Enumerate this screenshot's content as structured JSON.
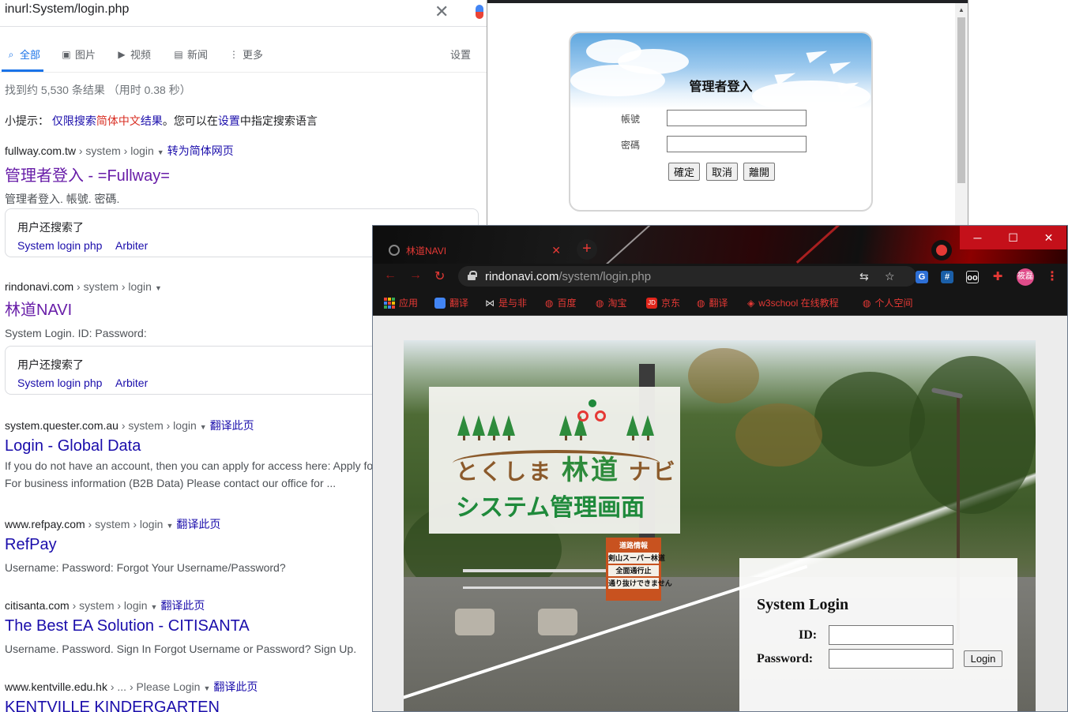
{
  "google": {
    "query": "inurl:System/login.php",
    "tabs": [
      {
        "label": "全部",
        "icon": "search-icon"
      },
      {
        "label": "图片",
        "icon": "image-icon"
      },
      {
        "label": "视频",
        "icon": "video-icon"
      },
      {
        "label": "新闻",
        "icon": "news-icon"
      },
      {
        "label": "更多",
        "icon": "more-icon"
      }
    ],
    "settings_label": "设置",
    "stats": "找到约 5,530 条结果 （用时 0.38 秒）",
    "hint": {
      "prefix": "小提示：",
      "link_a": "仅限搜索",
      "link_red": "简体中文",
      "link_b": "结果",
      "mid": "。您可以在",
      "settings_link": "设置",
      "suffix": "中指定搜索语言"
    },
    "results": [
      {
        "domain": "fullway.com.tw",
        "path": " › system › login",
        "action": "转为简体网页",
        "title": "管理者登入 - =Fullway=",
        "snippet": "管理者登入. 帳號. 密碼."
      },
      {
        "domain": "rindonavi.com",
        "path": " › system › login",
        "action": "",
        "title": "林道NAVI",
        "snippet": "System Login. ID: Password:"
      },
      {
        "domain": "system.quester.com.au",
        "path": " › system › login",
        "action": "翻译此页",
        "title": "Login - Global Data",
        "snippet1": "If you do not have an account, then you can apply for access here: Apply fo",
        "snippet2": "For business information (B2B Data) Please contact our office for ..."
      },
      {
        "domain": "www.refpay.com",
        "path": " › system › login",
        "action": "翻译此页",
        "title": "RefPay",
        "snippet": "Username: Password: Forgot Your Username/Password?"
      },
      {
        "domain": "citisanta.com",
        "path": " › system › login",
        "action": "翻译此页",
        "title": "The Best EA Solution - CITISANTA",
        "snippet": "Username. Password. Sign In Forgot Username or Password? Sign Up."
      },
      {
        "domain": "www.kentville.edu.hk",
        "path": " › ... › Please Login",
        "action": "翻译此页",
        "title": "KENTVILLE KINDERGARTEN"
      }
    ],
    "also_searched": {
      "heading": "用户还搜索了",
      "links": [
        "System login php",
        "Arbiter"
      ]
    }
  },
  "fullway_window": {
    "title": "管理者登入",
    "account_label": "帳號",
    "password_label": "密碼",
    "buttons": {
      "ok": "確定",
      "cancel": "取消",
      "leave": "離開"
    }
  },
  "chrome_window": {
    "tab_title": "林道NAVI",
    "url_host": "rindonavi.com",
    "url_path": "/system/login.php",
    "window_controls": {
      "minimize": "─",
      "maximize": "☐",
      "close": "✕"
    },
    "avatar_text": "筱磊",
    "bookmarks": [
      "应用",
      "翻译",
      "是与非",
      "百度",
      "淘宝",
      "京东",
      "翻译",
      "w3school 在线教程",
      "个人空间"
    ],
    "page": {
      "logo_line1": "とくしま",
      "logo_big": "林道",
      "logo_line1_end": "ナビ",
      "logo_sub": "システム管理画面",
      "sign_lines": [
        "道路情報",
        "剣山スーパー林道",
        "全面通行止",
        "通り抜けできません"
      ],
      "login_title": "System Login",
      "id_label": "ID:",
      "password_label": "Password:",
      "login_button": "Login"
    }
  }
}
